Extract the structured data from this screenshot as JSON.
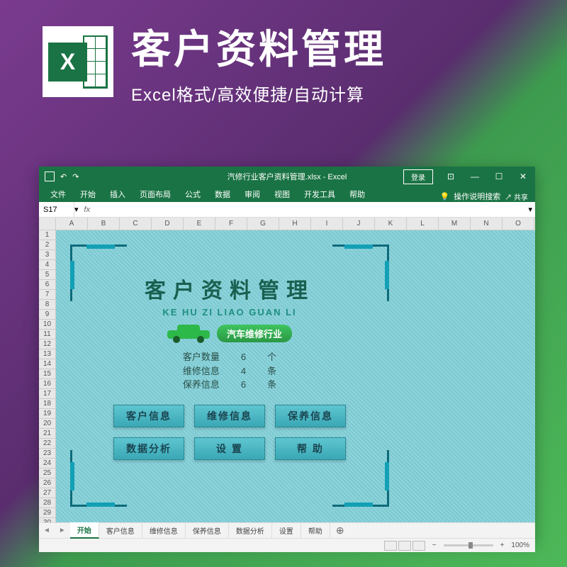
{
  "promo": {
    "title": "客户资料管理",
    "subtitle": "Excel格式/高效便捷/自动计算",
    "icon_letter": "X"
  },
  "titlebar": {
    "filename": "汽修行业客户资料管理.xlsx - Excel",
    "login": "登录"
  },
  "ribbon": {
    "tabs": [
      "文件",
      "开始",
      "插入",
      "页面布局",
      "公式",
      "数据",
      "审阅",
      "视图",
      "开发工具",
      "帮助"
    ],
    "search_hint": "操作说明搜索",
    "share": "共享"
  },
  "formula": {
    "cell_ref": "S17",
    "fx": "fx"
  },
  "columns": [
    "A",
    "B",
    "C",
    "D",
    "E",
    "F",
    "G",
    "H",
    "I",
    "J",
    "K",
    "L",
    "M",
    "N",
    "O"
  ],
  "rows": [
    1,
    2,
    3,
    4,
    5,
    6,
    7,
    8,
    9,
    10,
    11,
    12,
    13,
    14,
    15,
    16,
    17,
    18,
    19,
    20,
    21,
    22,
    23,
    24,
    25,
    26,
    27,
    28,
    29,
    30
  ],
  "dashboard": {
    "title": "客户资料管理",
    "pinyin": "KE HU ZI LIAO GUAN LI",
    "industry": "汽车维修行业",
    "stats": [
      {
        "label": "客户数量",
        "value": "6",
        "unit": "个"
      },
      {
        "label": "维修信息",
        "value": "4",
        "unit": "条"
      },
      {
        "label": "保养信息",
        "value": "6",
        "unit": "条"
      }
    ],
    "buttons": [
      "客户信息",
      "维修信息",
      "保养信息",
      "数据分析",
      "设  置",
      "帮  助"
    ]
  },
  "sheets": [
    "开始",
    "客户信息",
    "维修信息",
    "保养信息",
    "数据分析",
    "设置",
    "帮助"
  ],
  "statusbar": {
    "zoom": "100%"
  }
}
